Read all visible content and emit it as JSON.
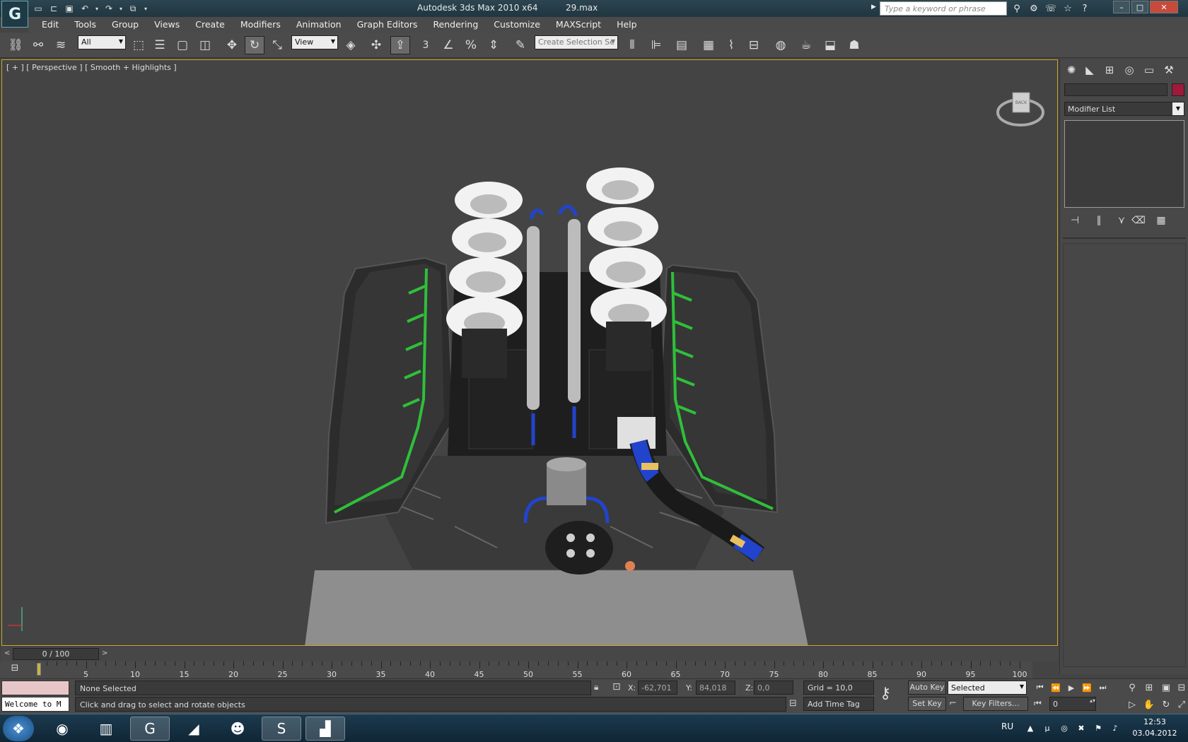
{
  "window": {
    "app_logo": "G",
    "title": "Autodesk 3ds Max  2010 x64",
    "file": "29.max",
    "search_placeholder": "Type a keyword or phrase"
  },
  "menu": [
    "Edit",
    "Tools",
    "Group",
    "Views",
    "Create",
    "Modifiers",
    "Animation",
    "Graph Editors",
    "Rendering",
    "Customize",
    "MAXScript",
    "Help"
  ],
  "toolbar": {
    "filter_selected": "All",
    "ref_coord_selected": "View",
    "snap_label": "3",
    "named_selection_placeholder": "Create Selection Se"
  },
  "viewport": {
    "label": "[ + ] [ Perspective ] [ Smooth + Highlights ]",
    "cube_face": "BACK"
  },
  "command_panel": {
    "modifier_list": "Modifier List"
  },
  "time_slider": {
    "frame_display": "0 / 100",
    "prev": "<",
    "next": ">"
  },
  "trackbar": {
    "labels": [
      "5",
      "10",
      "15",
      "20",
      "25",
      "30",
      "35",
      "40",
      "45",
      "50",
      "55",
      "60",
      "65",
      "70",
      "75",
      "80",
      "85",
      "90",
      "95",
      "100"
    ]
  },
  "status": {
    "maxscript_listener": "Welcome to M",
    "selection": "None Selected",
    "prompt": "Click and drag to select and rotate objects",
    "x_label": "X:",
    "x_value": "-62,701",
    "y_label": "Y:",
    "y_value": "84,018",
    "z_label": "Z:",
    "z_value": "0,0",
    "grid": "Grid = 10,0",
    "add_time_tag": "Add Time Tag",
    "auto_key": "Auto Key",
    "set_key": "Set Key",
    "selection_set": "Selected",
    "key_filters": "Key Filters...",
    "current_frame": "0"
  },
  "taskbar": {
    "lang": "RU",
    "time": "12:53",
    "date": "03.04.2012"
  },
  "colors": {
    "viewport_border": "#c9a82c",
    "object_color": "#9e1a3a",
    "engine_green": "#2fbf3a",
    "hose_blue": "#2244cc"
  }
}
